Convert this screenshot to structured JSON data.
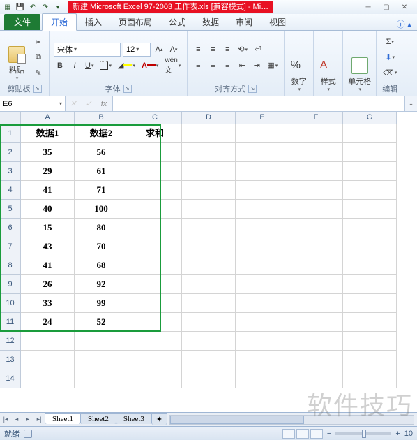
{
  "title": "新建 Microsoft Excel 97-2003 工作表.xls  [兼容模式] -  Mi…",
  "ribbon": {
    "file": "文件",
    "tabs": [
      "开始",
      "插入",
      "页面布局",
      "公式",
      "数据",
      "审阅",
      "视图"
    ],
    "active_tab": 0,
    "groups": {
      "clipboard": {
        "label": "剪贴板",
        "paste": "粘贴"
      },
      "font": {
        "label": "字体",
        "name": "宋体",
        "size": "12"
      },
      "align": {
        "label": "对齐方式"
      },
      "number": {
        "label": "",
        "btn": "数字"
      },
      "styles": {
        "label": "",
        "btn": "样式"
      },
      "cells": {
        "label": "",
        "btn": "单元格"
      },
      "editing": {
        "label": "编辑"
      }
    }
  },
  "namebox": "E6",
  "formula": "",
  "columns": [
    "A",
    "B",
    "C",
    "D",
    "E",
    "F",
    "G"
  ],
  "rows": [
    1,
    2,
    3,
    4,
    5,
    6,
    7,
    8,
    9,
    10,
    11,
    12,
    13,
    14
  ],
  "data": {
    "headers": [
      "数据1",
      "数据2",
      "求和"
    ],
    "values": [
      [
        35,
        56
      ],
      [
        29,
        61
      ],
      [
        41,
        71
      ],
      [
        40,
        100
      ],
      [
        15,
        80
      ],
      [
        43,
        70
      ],
      [
        41,
        68
      ],
      [
        26,
        92
      ],
      [
        33,
        99
      ],
      [
        24,
        52
      ]
    ]
  },
  "sheets": [
    "Sheet1",
    "Sheet2",
    "Sheet3"
  ],
  "active_sheet": 0,
  "status": {
    "ready": "就绪",
    "zoom": "10"
  },
  "watermark": "软件技巧"
}
